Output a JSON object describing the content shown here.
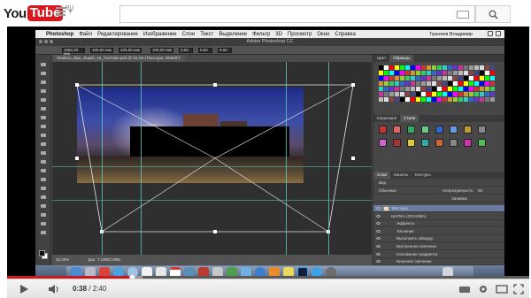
{
  "youtube": {
    "logo_you": "You",
    "logo_tube": "Tube",
    "region": "RU",
    "search": {
      "value": "",
      "placeholder": ""
    },
    "player": {
      "time_current": "0:38",
      "time_separator": " / ",
      "time_total": "2:40",
      "progress_fraction": 0.24,
      "buffer_fraction": 0.26
    }
  },
  "photoshop": {
    "menubar": {
      "app": "Photoshop",
      "items": [
        "Файл",
        "Редактирование",
        "Изображение",
        "Слои",
        "Текст",
        "Выделение",
        "Фильтр",
        "3D",
        "Просмотр",
        "Окно",
        "Справка"
      ],
      "user": "Граняев Владимир"
    },
    "window_title": "Adobe Photoshop CC",
    "document_tab": "Shablon_dlya_shapki_na_YouTube.psd @ 33,3% (Текстура, RGB/8*)",
    "options": [
      "1060,20 пик",
      "100,00 пик",
      "225,00 пик",
      "100,00 пик",
      "0,00",
      "0,00",
      "0,00"
    ],
    "status_bar": {
      "zoom": "33,33%",
      "doc_info": "Док: 7,10M/2,69M"
    },
    "panels": {
      "swatches_tabs": [
        "Цвет",
        "Образцы"
      ],
      "styles_tabs": [
        "Коррекция",
        "Стили"
      ],
      "layers_tabs": [
        "Слои",
        "Каналы",
        "Контуры"
      ],
      "layers_filter": "Вид",
      "blend_mode": "Обычные",
      "opacity_label": "Непрозрачность:",
      "opacity_value": "85",
      "fill_label": "Заливка:",
      "layers": [
        {
          "name": "Текстура",
          "selected": true
        },
        {
          "name": "ШАПКА (ОСНОВА)",
          "selected": false
        },
        {
          "name": "Эффекты",
          "selected": false
        },
        {
          "name": "Тиснение",
          "selected": false
        },
        {
          "name": "Выполнить обводку",
          "selected": false
        },
        {
          "name": "Внутреннее свечение",
          "selected": false
        },
        {
          "name": "Наложение градиента",
          "selected": false
        },
        {
          "name": "Внешнее свечение",
          "selected": false
        },
        {
          "name": "Внешнее свечение",
          "selected": false
        },
        {
          "name": "ТЕКС (ФОН/ОЕ)",
          "selected": false
        },
        {
          "name": "Эффекты",
          "selected": false
        }
      ]
    }
  },
  "colors": {
    "yt_red": "#cc181e",
    "ps_panel": "#474747",
    "guide": "#5fd6c8",
    "layer_selected": "#6b7ba0"
  }
}
